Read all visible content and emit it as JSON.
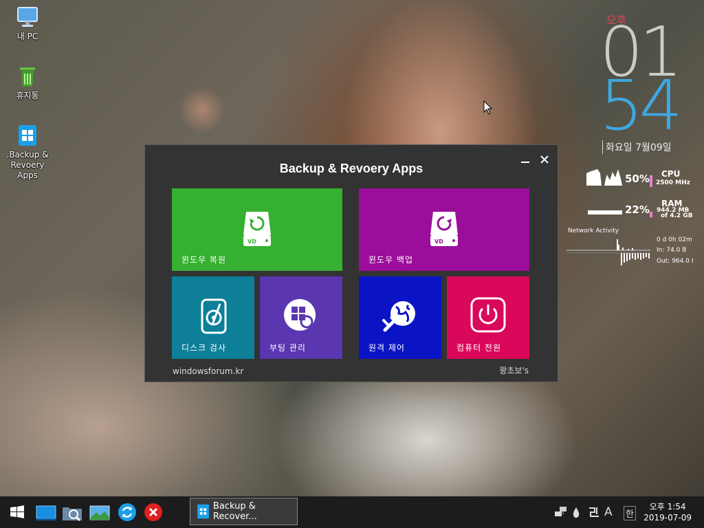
{
  "desktop": {
    "icons": [
      {
        "label": "내 PC"
      },
      {
        "label": "휴지통"
      },
      {
        "label_line1": ".Backup &",
        "label_line2": "Revoery Apps"
      }
    ]
  },
  "clock_widget": {
    "ampm": "오후",
    "hour": "01",
    "minute": "54",
    "date": "화요일 7월09일"
  },
  "sysmon": {
    "cpu": {
      "percent": "50%",
      "label": "CPU",
      "detail": "2500 MHz",
      "level": 0.5
    },
    "ram": {
      "percent": "22%",
      "label": "RAM",
      "used": "944.2 MB",
      "total": "of  4.2 GB",
      "level": 0.22
    },
    "network": {
      "title": "Network Activity",
      "uptime": "0 d 0h 02m",
      "in": "In: 74.0 B",
      "out": "Out: 964.0 I"
    }
  },
  "window": {
    "title": "Backup & Revoery Apps",
    "footer_left": "windowsforum.kr",
    "footer_right": "왕초보's",
    "tiles": [
      {
        "label": "윈도우 복원",
        "color": "#36b031",
        "icon_text": "VD"
      },
      {
        "label": "윈도우 백업",
        "color": "#9b0d9b",
        "icon_text": "VD"
      },
      {
        "label": "디스크 검사",
        "color": "#0d7f98"
      },
      {
        "label": "부팅 관리",
        "color": "#5a36b0"
      },
      {
        "label": "원격 제어",
        "color": "#0b14c4"
      },
      {
        "label": "컴퓨터 전원",
        "color": "#d9085a"
      }
    ]
  },
  "taskbar": {
    "task_label": "Backup & Recover...",
    "tray_a": "A",
    "tray_lang": "한",
    "time": "오후 1:54",
    "date": "2019-07-09"
  }
}
